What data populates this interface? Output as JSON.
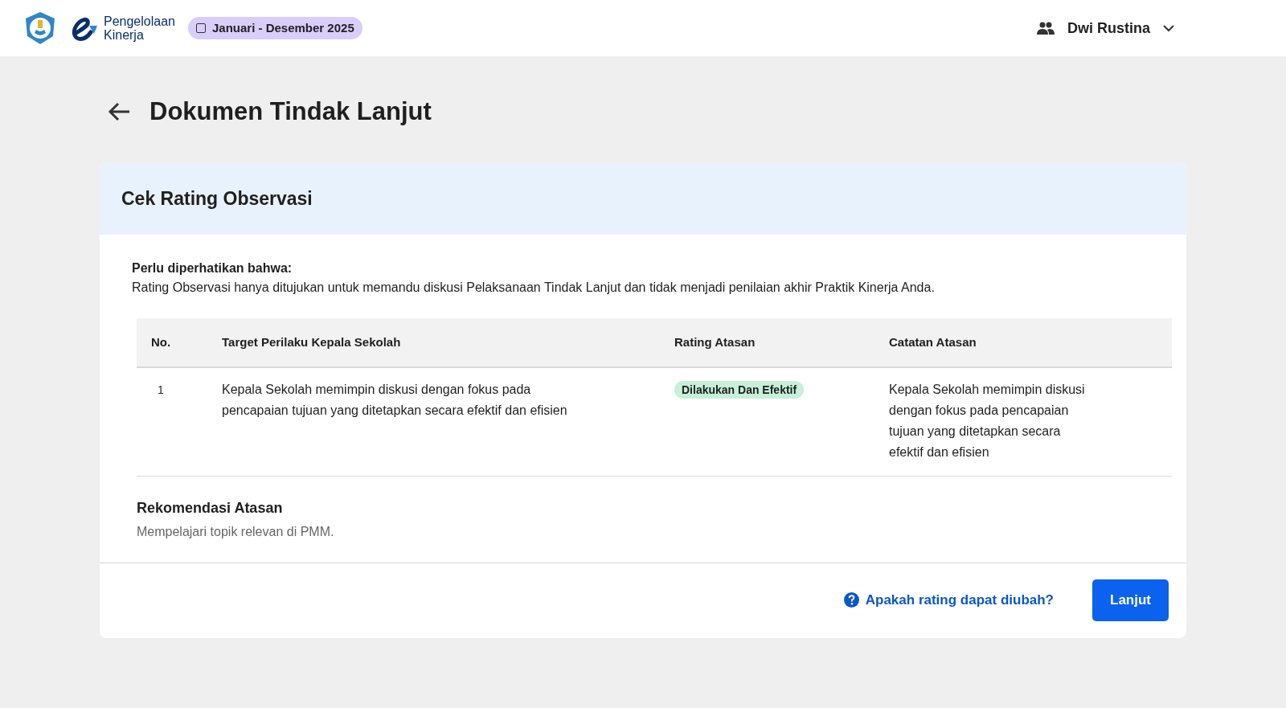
{
  "header": {
    "app_name": "Pengelolaan\nKinerja",
    "period": "Januari - Desember 2025",
    "user": "Dwi Rustina"
  },
  "page_title": "Dokumen Tindak Lanjut",
  "card": {
    "title": "Cek Rating Observasi",
    "notice_title": "Perlu diperhatikan bahwa:",
    "notice_text": "Rating Observasi hanya ditujukan untuk memandu diskusi Pelaksanaan Tindak Lanjut dan tidak menjadi penilaian akhir Praktik Kinerja Anda.",
    "table": {
      "columns": [
        "No.",
        "Target Perilaku Kepala Sekolah",
        "Rating Atasan",
        "Catatan Atasan"
      ],
      "rows": [
        {
          "no": "1",
          "target": "Kepala Sekolah memimpin diskusi dengan fokus pada pencapaian tujuan yang ditetapkan secara efektif dan efisien",
          "rating": "Dilakukan Dan Efektif",
          "note": "Kepala Sekolah memimpin diskusi dengan fokus pada pencapaian tujuan yang ditetapkan secara efektif dan efisien"
        }
      ]
    },
    "recommendation_title": "Rekomendasi Atasan",
    "recommendation_text": "Mempelajari topik relevan di PMM.",
    "help_link": "Apakah rating dapat diubah?",
    "next_button": "Lanjut"
  }
}
